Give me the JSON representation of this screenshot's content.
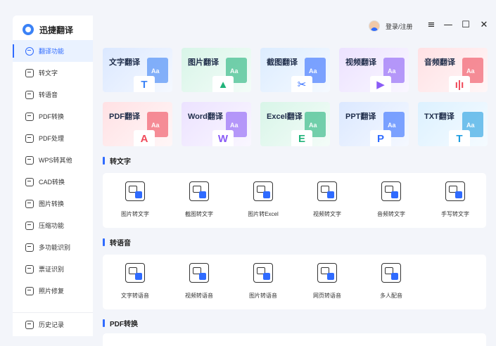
{
  "app": {
    "name": "迅捷翻译"
  },
  "header": {
    "login_label": "登录/注册",
    "menu_icon": "≡",
    "minimize_icon": "—",
    "maximize_icon": "☐",
    "close_icon": "✕"
  },
  "sidebar": {
    "items": [
      {
        "label": "翻译功能",
        "icon": "translate-icon",
        "active": true
      },
      {
        "label": "转文字",
        "icon": "text-icon"
      },
      {
        "label": "转语音",
        "icon": "voice-icon"
      },
      {
        "label": "PDF转换",
        "icon": "pdf-convert-icon"
      },
      {
        "label": "PDF处理",
        "icon": "pdf-process-icon"
      },
      {
        "label": "WPS转其他",
        "icon": "wps-icon"
      },
      {
        "label": "CAD转换",
        "icon": "cad-icon"
      },
      {
        "label": "图片转换",
        "icon": "image-convert-icon"
      },
      {
        "label": "压缩功能",
        "icon": "compress-icon"
      },
      {
        "label": "多功能识别",
        "icon": "recognize-icon"
      },
      {
        "label": "票证识别",
        "icon": "ticket-icon"
      },
      {
        "label": "照片修复",
        "icon": "photo-repair-icon"
      }
    ],
    "history_label": "历史记录"
  },
  "translate_cards": [
    {
      "label": "文字翻译",
      "glyph": "T",
      "color": "#dbe8ff",
      "accent": "#3b82f6"
    },
    {
      "label": "图片翻译",
      "glyph": "▲",
      "color": "#d8f5e8",
      "accent": "#21b37a"
    },
    {
      "label": "截图翻译",
      "glyph": "✂",
      "color": "#dcecff",
      "accent": "#2f6bff"
    },
    {
      "label": "视频翻译",
      "glyph": "▶",
      "color": "#ece2ff",
      "accent": "#8a5cf6"
    },
    {
      "label": "音频翻译",
      "glyph": "ı|ı",
      "color": "#ffe1e4",
      "accent": "#f04a5a"
    },
    {
      "label": "PDF翻译",
      "glyph": "A",
      "color": "#ffe1e4",
      "accent": "#f04a5a"
    },
    {
      "label": "Word翻译",
      "glyph": "W",
      "color": "#ece2ff",
      "accent": "#8a5cf6"
    },
    {
      "label": "Excel翻译",
      "glyph": "E",
      "color": "#d8f5e8",
      "accent": "#21b37a"
    },
    {
      "label": "PPT翻译",
      "glyph": "P",
      "color": "#dbe8ff",
      "accent": "#2f6bff"
    },
    {
      "label": "TXT翻译",
      "glyph": "T",
      "color": "#dcf1ff",
      "accent": "#1f9de0"
    }
  ],
  "card_back_text": "Aa",
  "sections": {
    "to_text": {
      "title": "转文字",
      "tools": [
        "图片转文字",
        "截图转文字",
        "图片转Excel",
        "视频转文字",
        "音频转文字",
        "手写转文字"
      ]
    },
    "to_voice": {
      "title": "转语音",
      "tools": [
        "文字转语音",
        "视频转语音",
        "图片转语音",
        "网页转语音",
        "多人配音"
      ]
    },
    "pdf": {
      "title": "PDF转换"
    }
  }
}
